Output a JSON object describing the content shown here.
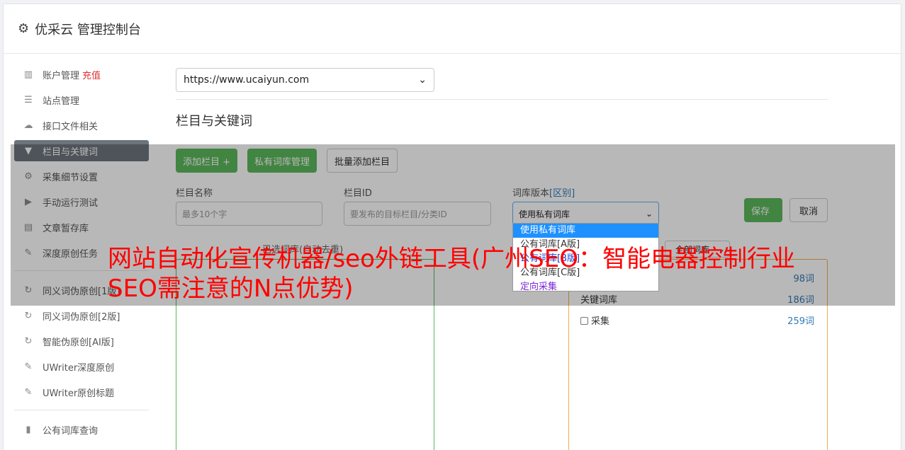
{
  "header": {
    "title": "优采云 管理控制台"
  },
  "sidebar": {
    "items": [
      {
        "label": "账户管理",
        "badge": "充值",
        "icon": "bar-chart-icon"
      },
      {
        "label": "站点管理",
        "icon": "server-icon"
      },
      {
        "label": "接口文件相关",
        "icon": "cloud-upload-icon"
      },
      {
        "label": "栏目与关键词",
        "icon": "filter-icon",
        "active": true
      },
      {
        "label": "采集细节设置",
        "icon": "gears-icon"
      },
      {
        "label": "手动运行测试",
        "icon": "play-icon"
      },
      {
        "label": "文章暂存库",
        "icon": "database-icon"
      },
      {
        "label": "深度原创任务",
        "icon": "edit-icon"
      },
      {
        "label": "同义词伪原创[1版]",
        "icon": "refresh-icon"
      },
      {
        "label": "同义词伪原创[2版]",
        "icon": "refresh-icon"
      },
      {
        "label": "智能伪原创[AI版]",
        "icon": "refresh-icon"
      },
      {
        "label": "UWriter深度原创",
        "icon": "edit-icon"
      },
      {
        "label": "UWriter原创标题",
        "icon": "edit-icon"
      },
      {
        "label": "公有词库查询",
        "icon": "book-icon"
      }
    ]
  },
  "main": {
    "site_select": {
      "value": "https://www.ucaiyun.com"
    },
    "section_title": "栏目与关键词",
    "buttons": {
      "add_column": "添加栏目 +",
      "private_lib": "私有词库管理",
      "batch_add": "批量添加栏目"
    },
    "form": {
      "name_label": "栏目名称",
      "name_placeholder": "最多10个字",
      "id_label": "栏目ID",
      "id_placeholder": "要发布的目标栏目/分类ID",
      "version_label": "词库版本",
      "version_link": "[区别]",
      "version_value": "使用私有词库",
      "save": "保存",
      "cancel": "取消"
    },
    "dropdown_options": [
      {
        "label": "使用私有词库",
        "style": "selected"
      },
      {
        "label": "公有词库[A版]",
        "style": "normal"
      },
      {
        "label": "公有词库[B版]",
        "style": "blue"
      },
      {
        "label": "公有词库[C版]",
        "style": "normal"
      },
      {
        "label": "定向采集",
        "style": "purple"
      }
    ],
    "selected_lists_label": "已选词库(自动去重)",
    "lib_filter": "全部词库",
    "libraries": [
      {
        "name": "",
        "count": "98词"
      },
      {
        "name": "关键词库",
        "count": "186词"
      },
      {
        "name": "采集",
        "count": "259词"
      }
    ]
  },
  "headline": "网站自动化宣传机器/seo外链工具(广州SEO：智能电器控制行业SEO需注意的N点优势)"
}
